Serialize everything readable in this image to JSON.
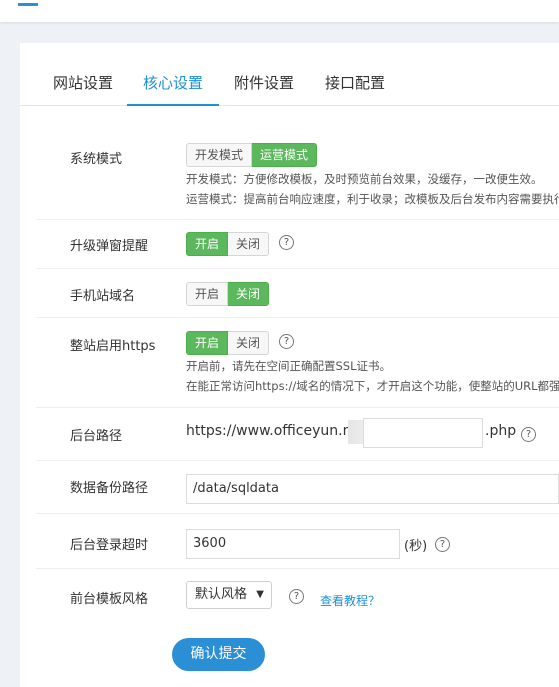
{
  "tabs": [
    "网站设置",
    "核心设置",
    "附件设置",
    "接口配置"
  ],
  "system_mode": {
    "label": "系统模式",
    "options": [
      "开发模式",
      "运营模式"
    ],
    "notes": [
      "开发模式：方便修改模板，及时预览前台效果，没缓存，一改便生效。",
      "运营模式：提高前台响应速度，利于收录；改模板及后台发布内容需要执行"
    ]
  },
  "upgrade_popup": {
    "label": "升级弹窗提醒",
    "options": [
      "开启",
      "关闭"
    ],
    "help": "?"
  },
  "mobile_domain": {
    "label": "手机站域名",
    "options": [
      "开启",
      "关闭"
    ]
  },
  "https": {
    "label": "整站启用https",
    "options": [
      "开启",
      "关闭"
    ],
    "help": "?",
    "notes": [
      "开启前，请先在空间正确配置SSL证书。",
      "在能正常访问https://域名的情况下，才开启这个功能，使整站的URL都强"
    ]
  },
  "admin_path": {
    "label": "后台路径",
    "prefix": "https://www.officeyun.n",
    "suffix": ".php",
    "help": "?"
  },
  "backup_path": {
    "label": "数据备份路径",
    "value": "/data/sqldata"
  },
  "login_timeout": {
    "label": "后台登录超时",
    "value": "3600",
    "unit": "(秒)",
    "help": "?"
  },
  "template_style": {
    "label": "前台模板风格",
    "selected": "默认风格",
    "help": "?",
    "tutorial": "查看教程？"
  },
  "submit_label": "确认提交",
  "colors": {
    "accent": "#1e90d6",
    "toggle_on": "#5cb85c"
  }
}
